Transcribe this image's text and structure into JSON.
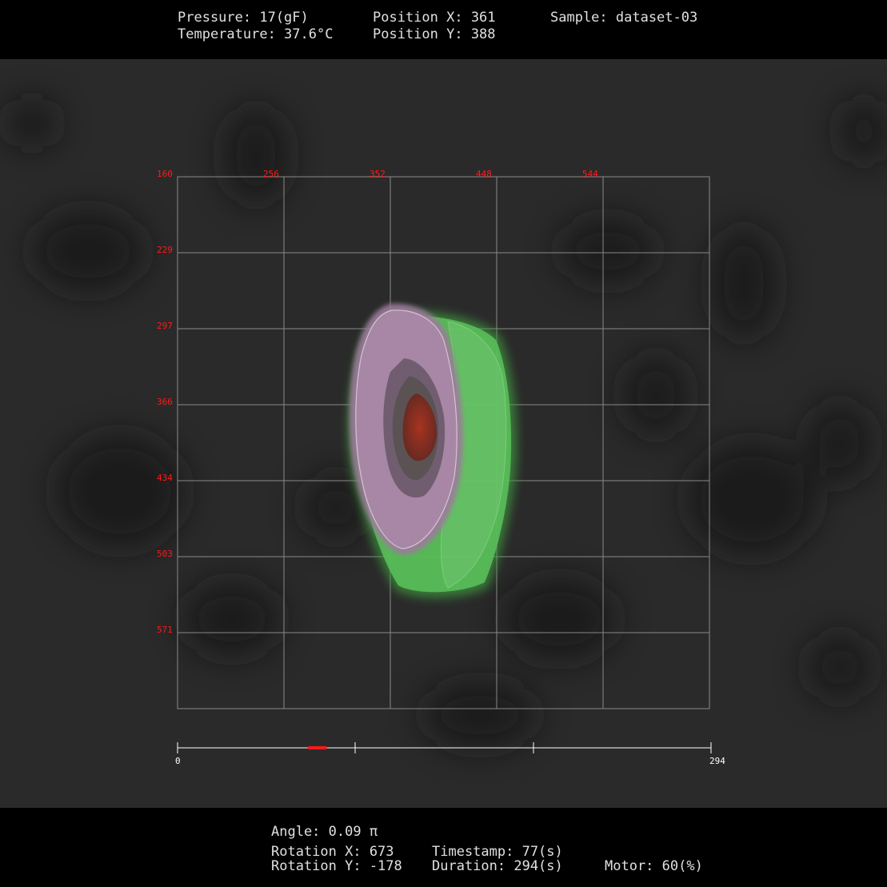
{
  "header": {
    "pressure": "Pressure: 17(gF)",
    "temperature": "Temperature: 37.6°C",
    "position_x": "Position X: 361",
    "position_y": "Position Y: 388",
    "sample": "Sample: dataset-03"
  },
  "grid": {
    "x_ticks": [
      "160",
      "256",
      "352",
      "448",
      "544"
    ],
    "y_ticks": [
      "229",
      "297",
      "366",
      "434",
      "503",
      "571"
    ]
  },
  "timeline": {
    "start_label": "0",
    "end_label": "294",
    "current": 77,
    "max": 294,
    "marker_color": "#ff1a1a"
  },
  "footer": {
    "angle": "Angle: 0.09 π",
    "rotation_x": "Rotation X: 673",
    "rotation_y": "Rotation Y: -178",
    "timestamp": "Timestamp: 77(s)",
    "duration": "Duration: 294(s)",
    "motor": "Motor: 60(%)"
  },
  "compass": {
    "icon": "compass-icon",
    "needle_color": "#ff1a1a"
  },
  "colors": {
    "tick_labels": "#ff1a1a",
    "grid": "#9a9a9a",
    "shell_outer": "#5fd35f",
    "shell_inner": "#a77aa6",
    "core": "#8b2a1c"
  }
}
